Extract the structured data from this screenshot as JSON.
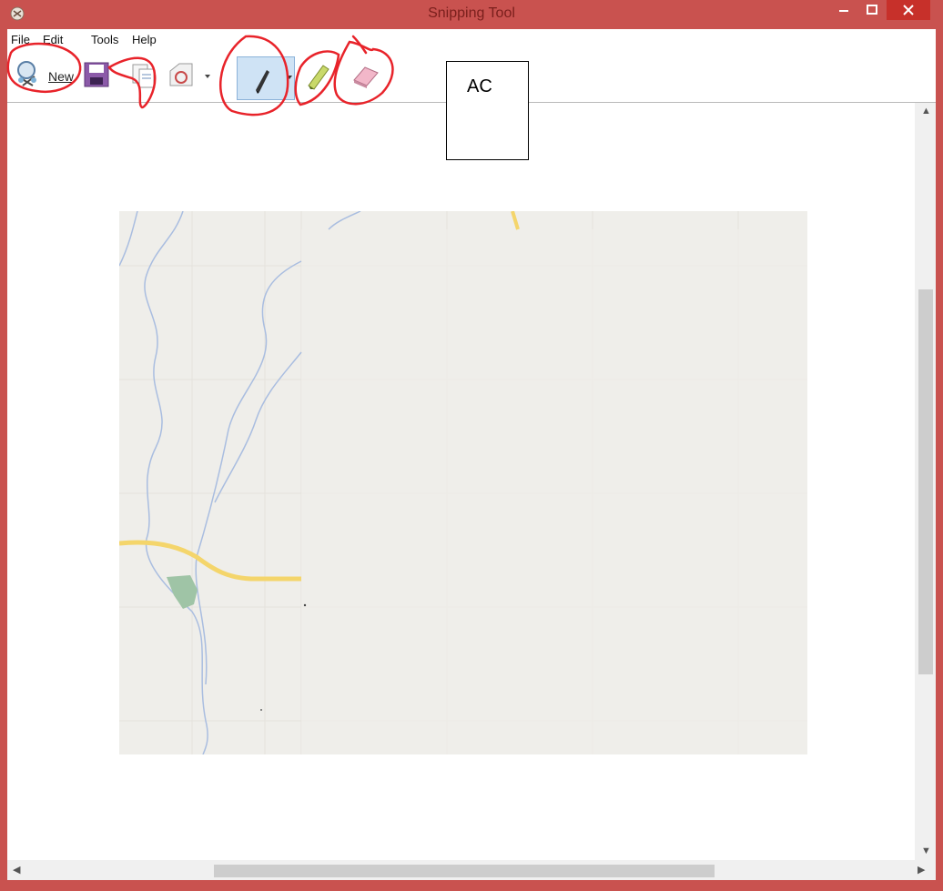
{
  "window": {
    "title": "Snipping Tool",
    "app_icon": "scissors-app-icon",
    "controls": [
      "minimize-icon",
      "maximize-icon",
      "close-icon"
    ]
  },
  "menu": {
    "items": [
      "File",
      "Edit",
      "Tools",
      "Help"
    ]
  },
  "toolbar": {
    "new_label": "New",
    "icons": [
      "new-snip-icon",
      "save-icon",
      "copy-icon",
      "send-snip-icon",
      "pen-icon",
      "highlighter-icon",
      "eraser-icon"
    ]
  },
  "annotation": {
    "label": "AC",
    "stroke_color": "#e8232a"
  },
  "map": {
    "road_color": "#f4d56b",
    "water_color": "#a9bde0",
    "park_color": "#9fc4a6",
    "background": "#efeeea"
  },
  "colors": {
    "title_bar": "#c9524f",
    "close_button": "#c7302a",
    "pen_active": "#cfe3f5"
  }
}
